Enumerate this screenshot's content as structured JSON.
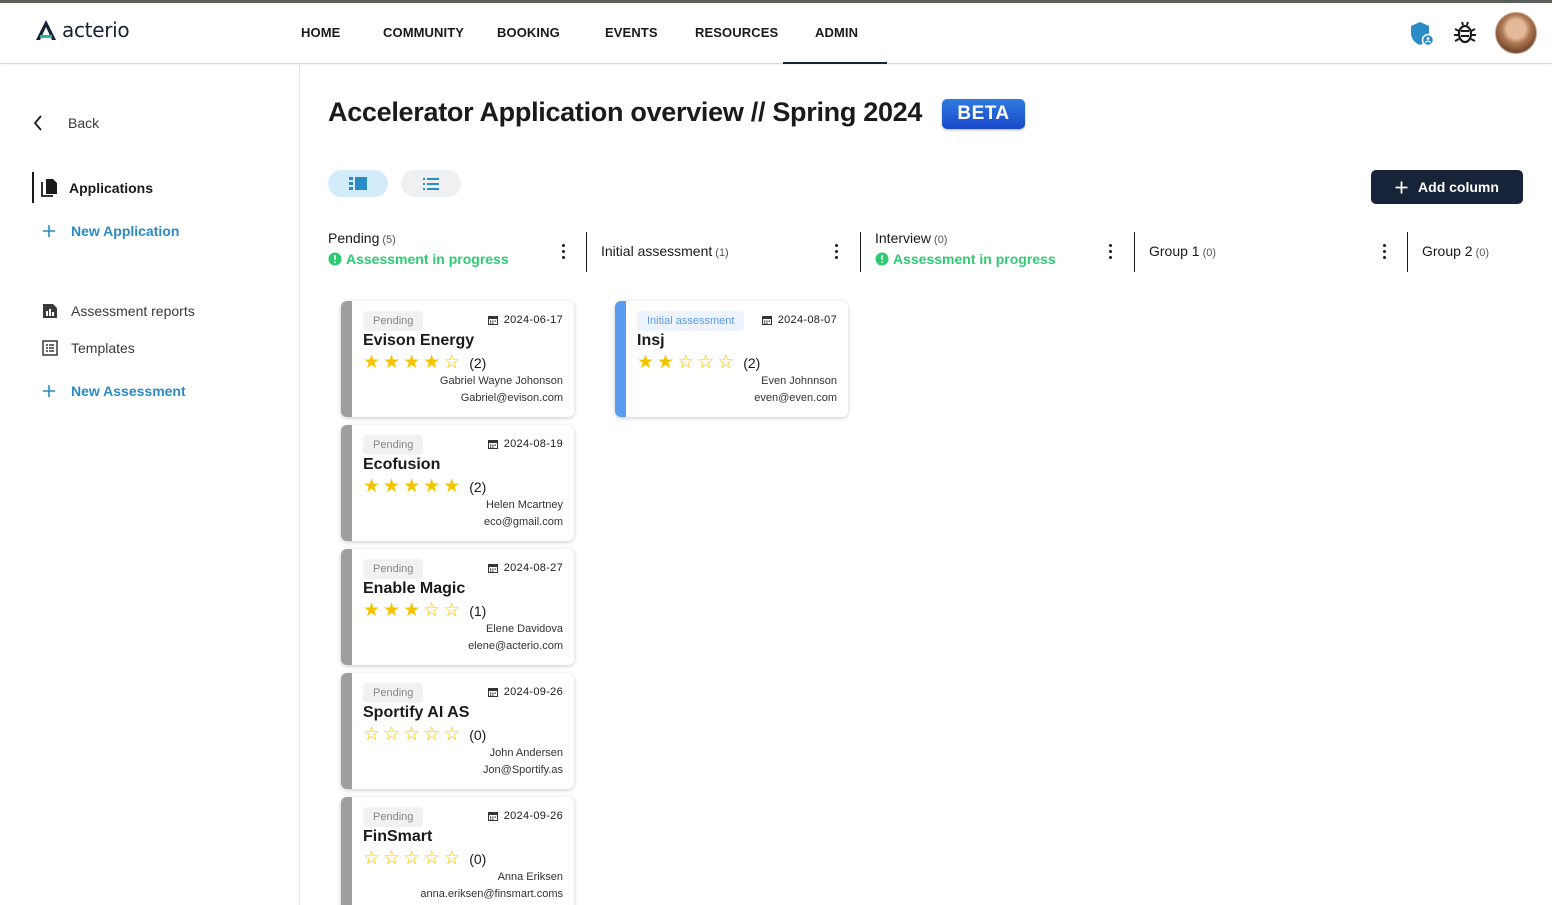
{
  "brand": {
    "name": "acterio"
  },
  "nav": [
    {
      "label": "HOME",
      "active": false
    },
    {
      "label": "COMMUNITY",
      "active": false
    },
    {
      "label": "BOOKING",
      "active": false
    },
    {
      "label": "EVENTS",
      "active": false
    },
    {
      "label": "RESOURCES",
      "active": false
    },
    {
      "label": "ADMIN",
      "active": true
    }
  ],
  "header_icons": [
    "shield-icon",
    "bug-icon",
    "avatar"
  ],
  "sidebar": {
    "back_label": "Back",
    "items": [
      {
        "label": "Applications",
        "icon": "documents-icon",
        "active": true
      },
      {
        "label": "New Application",
        "icon": "plus-icon",
        "link": true
      },
      {
        "label": "Assessment reports",
        "icon": "report-icon"
      },
      {
        "label": "Templates",
        "icon": "list-icon"
      },
      {
        "label": "New Assessment",
        "icon": "plus-icon",
        "link": true
      }
    ]
  },
  "page": {
    "title": "Accelerator Application overview // Spring 2024",
    "badge": "BETA",
    "add_column_label": "Add column"
  },
  "columns": [
    {
      "name": "Pending",
      "count": "(5)",
      "status": "Assessment in progress"
    },
    {
      "name": "Initial assessment",
      "count": "(1)",
      "status": ""
    },
    {
      "name": "Interview",
      "count": "(0)",
      "status": "Assessment in progress"
    },
    {
      "name": "Group 1",
      "count": "(0)",
      "status": ""
    },
    {
      "name": "Group 2",
      "count": "(0)",
      "status": ""
    }
  ],
  "cards": [
    {
      "column": 0,
      "stage": "Pending",
      "date": "2024-06-17",
      "name": "Evison Energy",
      "rating": 4,
      "reviews": "(2)",
      "contact": "Gabriel Wayne Johonson",
      "email": "Gabriel@evison.com"
    },
    {
      "column": 0,
      "stage": "Pending",
      "date": "2024-08-19",
      "name": "Ecofusion",
      "rating": 5,
      "reviews": "(2)",
      "contact": "Helen Mcartney",
      "email": "eco@gmail.com"
    },
    {
      "column": 0,
      "stage": "Pending",
      "date": "2024-08-27",
      "name": "Enable Magic",
      "rating": 3,
      "reviews": "(1)",
      "contact": "Elene Davidova",
      "email": "elene@acterio.com"
    },
    {
      "column": 0,
      "stage": "Pending",
      "date": "2024-09-26",
      "name": "Sportify AI AS",
      "rating": 0,
      "reviews": "(0)",
      "contact": "John Andersen",
      "email": "Jon@Sportify.as"
    },
    {
      "column": 0,
      "stage": "Pending",
      "date": "2024-09-26",
      "name": "FinSmart",
      "rating": 0,
      "reviews": "(0)",
      "contact": "Anna Eriksen",
      "email": "anna.eriksen@finsmart.coms"
    },
    {
      "column": 1,
      "stage": "Initial assessment",
      "date": "2024-08-07",
      "name": "Insj",
      "rating": 2,
      "reviews": "(2)",
      "contact": "Even Johnnson",
      "email": "even@even.com"
    }
  ],
  "colors": {
    "pending_bar": "#9e9e9e",
    "initial_bar": "#5b9cf0",
    "status_green": "#2ecc71",
    "star_gold": "#f5c400",
    "link_blue": "#2a8bc7",
    "dark_navy": "#172338"
  }
}
